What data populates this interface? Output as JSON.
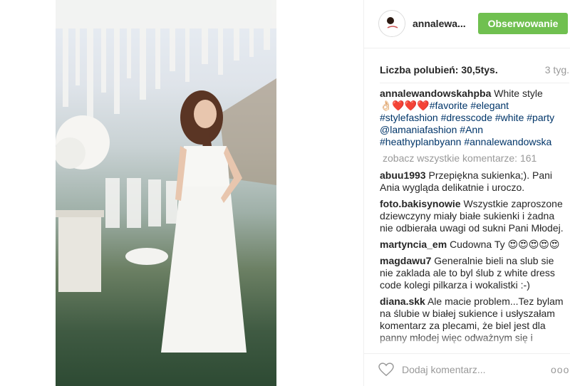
{
  "header": {
    "username": "annalewa...",
    "follow_label": "Obserwowanie"
  },
  "stats": {
    "likes_label": "Liczba polubień:",
    "likes_count": "30,5tys.",
    "time": "3 tyg."
  },
  "caption": {
    "user": "annalewandowskahpba",
    "text": "White style",
    "emoji": "👌🏻❤️❤️❤️",
    "tags": [
      "#favorite",
      "#elegant",
      "#stylefashion",
      "#dresscode",
      "#white",
      "#party",
      "@lamaniafashion",
      "#Ann",
      "#heathyplanbyann",
      "#annalewandowska"
    ]
  },
  "see_all": "zobacz wszystkie komentarze: 161",
  "comments": [
    {
      "user": "abuu1993",
      "text": "Przepiękna sukienka;). Pani Ania wygląda delikatnie i uroczo."
    },
    {
      "user": "foto.bakisynowie",
      "text": "Wszystkie zaproszone dziewczyny miały białe sukienki i żadna nie odbierała uwagi od sukni Pani Młodej."
    },
    {
      "user": "martyncia_em",
      "text": "Cudowna Ty 😍😍😍😍😍"
    },
    {
      "user": "magdawu7",
      "text": "Generalnie bieli na slub sie nie zaklada ale to byl ślub z white dress code kolegi pilkarza i wokalistki :-)"
    },
    {
      "user": "diana.skk",
      "text": "Ale macie problem...Tez bylam na ślubie w białej sukience i usłyszałam komentarz za plecami, że biel jest dla panny młodej więc odważnym się i"
    }
  ],
  "footer": {
    "add_comment_placeholder": "Dodaj komentarz...",
    "more_label": "ooo"
  },
  "icons": {
    "heart": "heart-icon",
    "more": "more-options-icon"
  },
  "colors": {
    "follow_button": "#70c050",
    "hashtag": "#003569",
    "muted": "#999999"
  }
}
